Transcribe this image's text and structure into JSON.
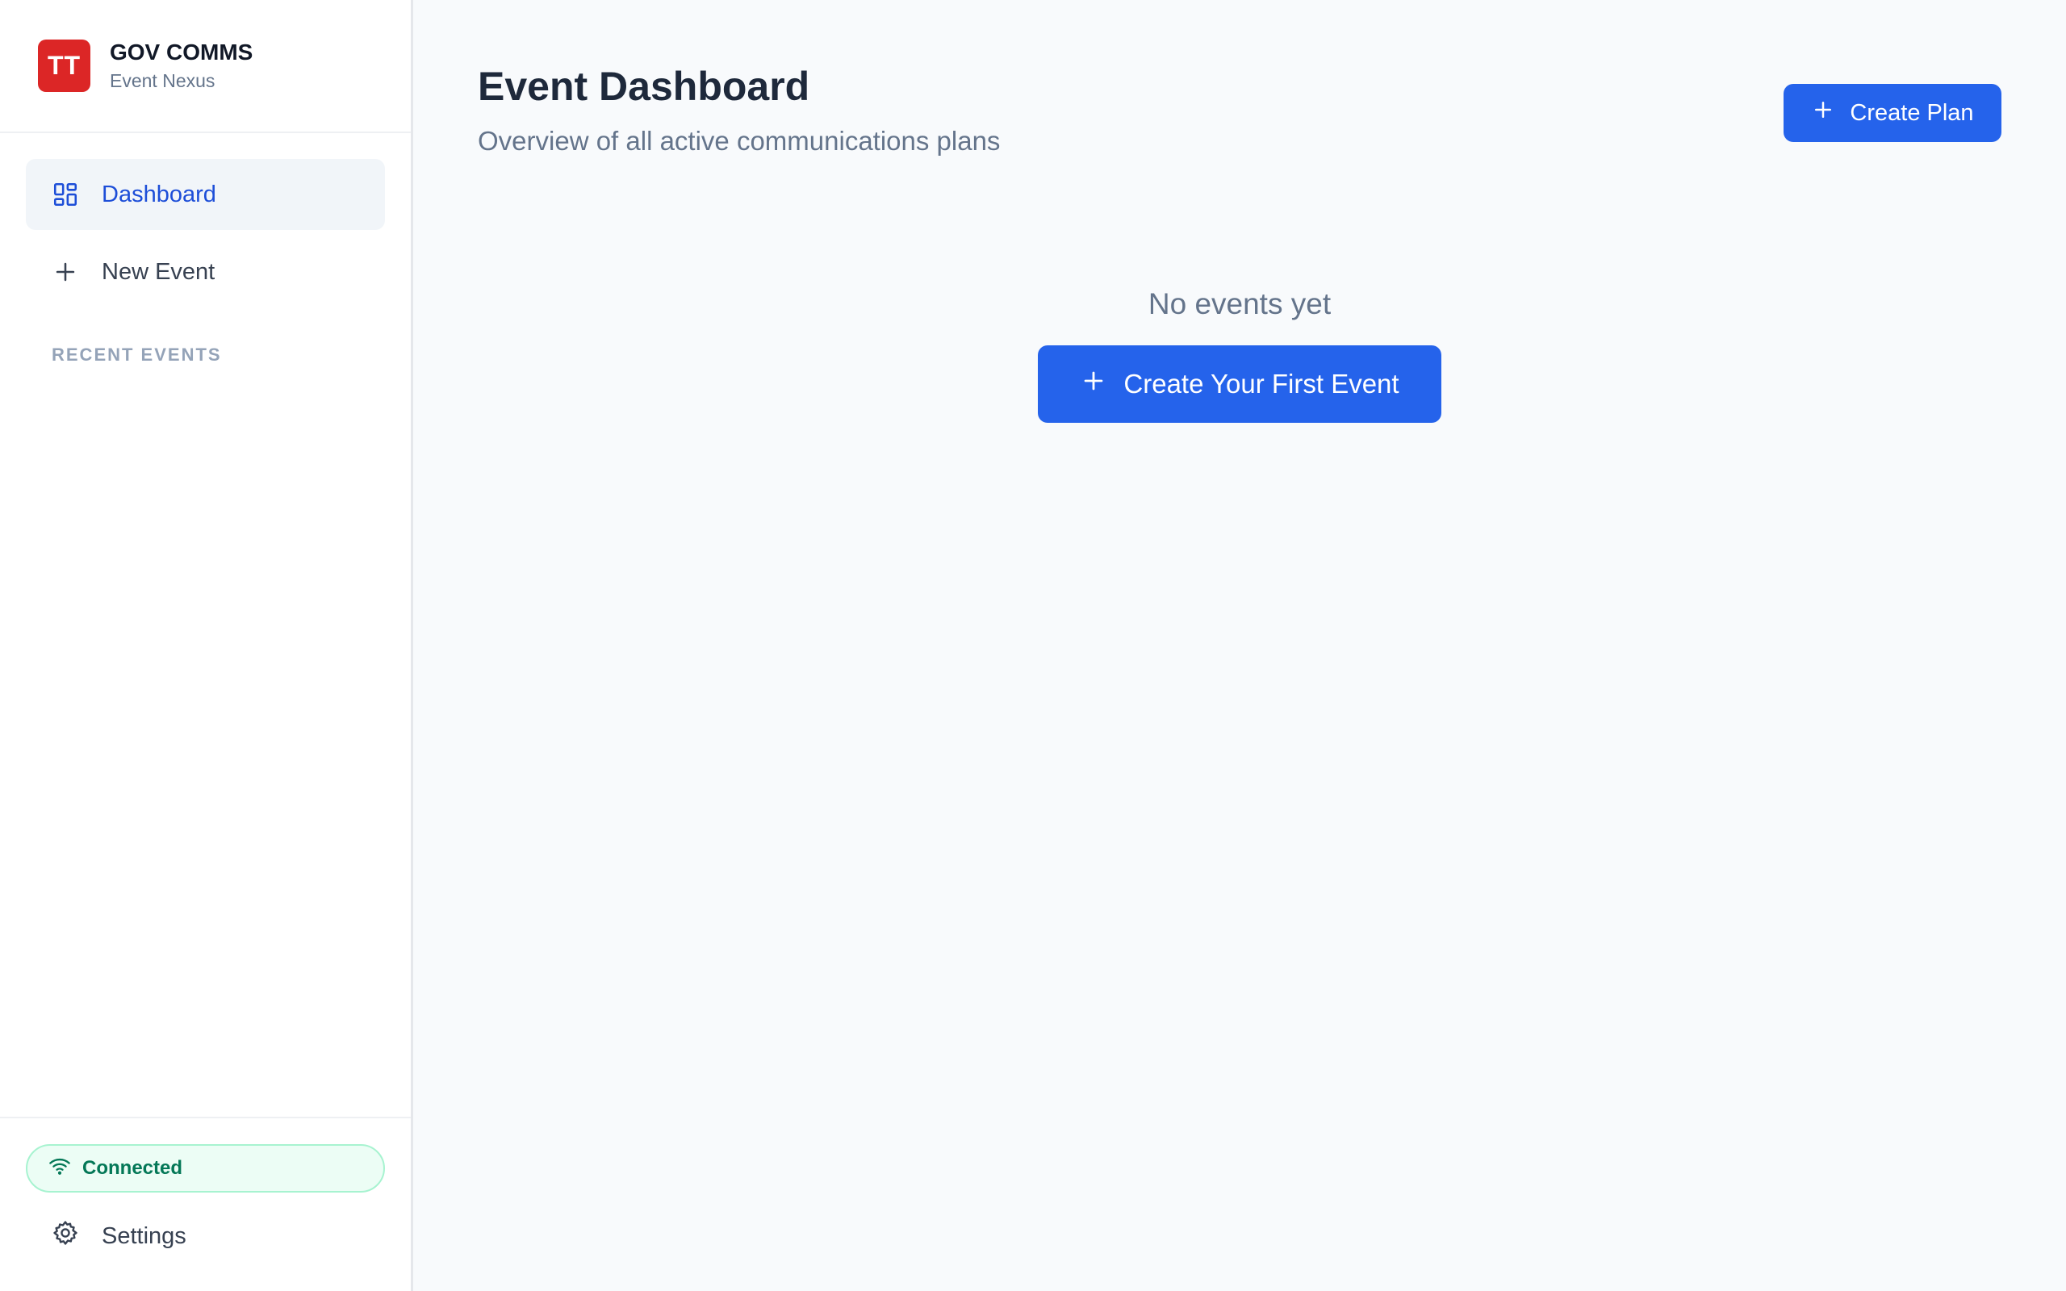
{
  "brand": {
    "logo_text": "TT",
    "title": "GOV COMMS",
    "subtitle": "Event Nexus"
  },
  "nav": {
    "items": [
      {
        "label": "Dashboard",
        "icon": "dashboard-grid-icon",
        "active": true
      },
      {
        "label": "New Event",
        "icon": "plus-icon",
        "active": false
      }
    ],
    "recent_section_label": "RECENT EVENTS"
  },
  "footer": {
    "status_label": "Connected",
    "status_icon": "wifi-icon",
    "settings_label": "Settings",
    "settings_icon": "gear-icon"
  },
  "main": {
    "title": "Event Dashboard",
    "subtitle": "Overview of all active communications plans",
    "create_plan_label": "Create Plan",
    "empty_text": "No events yet",
    "create_first_label": "Create Your First Event"
  },
  "colors": {
    "accent": "#2563eb",
    "brand_red": "#dc2626",
    "status_green": "#047857"
  }
}
